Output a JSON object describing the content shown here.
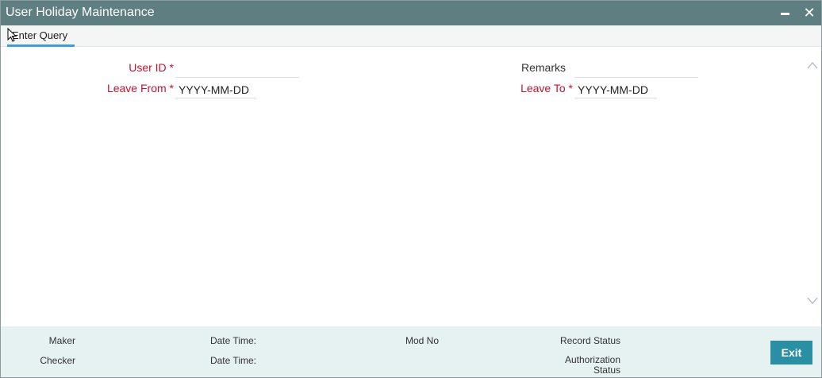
{
  "window": {
    "title": "User Holiday Maintenance",
    "minimize_glyph": "",
    "close_glyph": "✕"
  },
  "toolbar": {
    "enter_query_label": "Enter Query"
  },
  "form": {
    "user_id_label": "User ID",
    "user_id_value": "",
    "leave_from_label": "Leave From",
    "leave_from_placeholder": "YYYY-MM-DD",
    "remarks_label": "Remarks",
    "remarks_value": "",
    "leave_to_label": "Leave To",
    "leave_to_placeholder": "YYYY-MM-DD",
    "required_marker": "*"
  },
  "footer": {
    "maker_label": "Maker",
    "checker_label": "Checker",
    "date_time_label_1": "Date Time:",
    "date_time_label_2": "Date Time:",
    "mod_no_label": "Mod No",
    "record_status_label": "Record Status",
    "authorization_status_line1": "Authorization",
    "authorization_status_line2": "Status",
    "exit_label": "Exit"
  },
  "colors": {
    "titlebar": "#5e7e82",
    "required_label": "#c8102e",
    "tab_underline": "#3aa0d4",
    "footer_bg": "#e6f1f2",
    "exit_button": "#2a8fa5"
  }
}
